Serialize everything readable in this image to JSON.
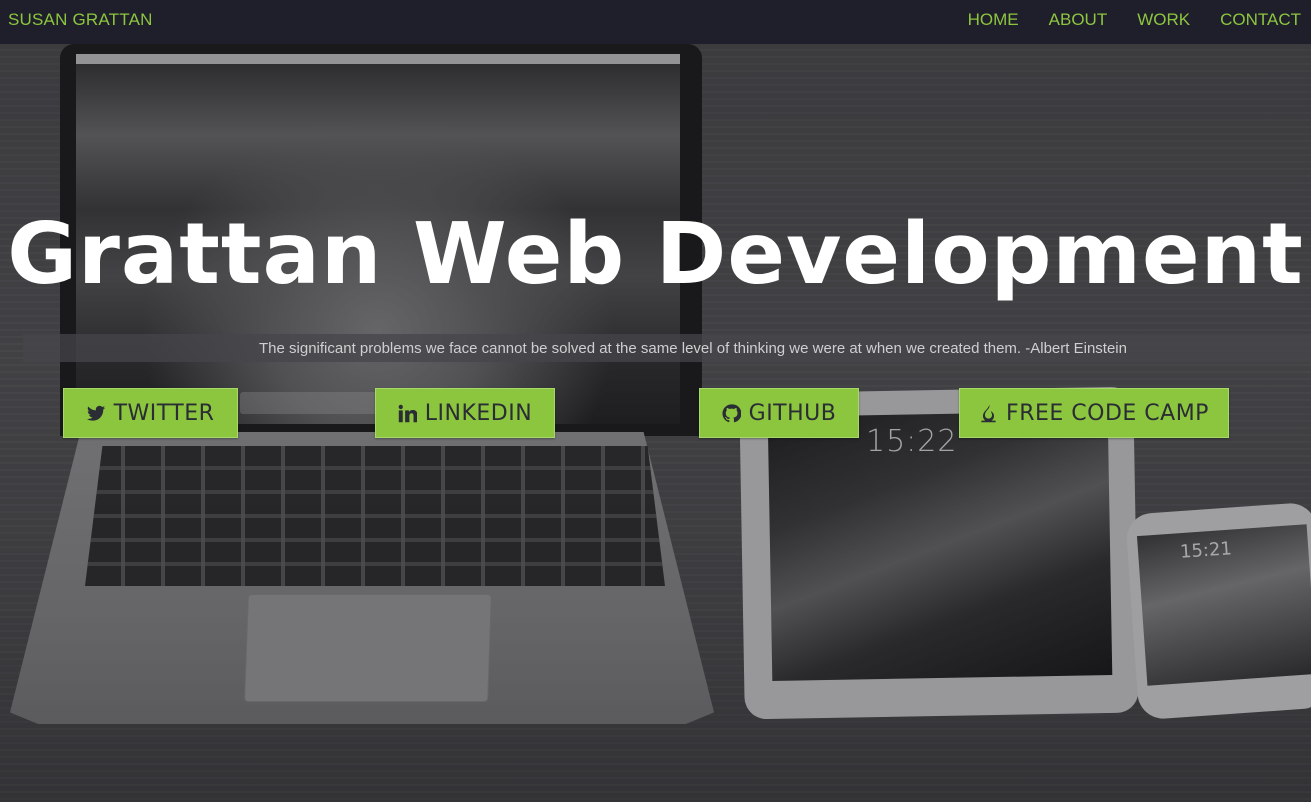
{
  "nav": {
    "brand": "SUSAN GRATTAN",
    "links": [
      "HOME",
      "ABOUT",
      "WORK",
      "CONTACT"
    ]
  },
  "hero": {
    "title": "Grattan Web Development",
    "quote": "The significant problems we face cannot be solved at the same level of thinking we were at when we created them. -Albert Einstein"
  },
  "social": [
    {
      "label": "TWITTER",
      "icon": "twitter-icon"
    },
    {
      "label": "LINKEDIN",
      "icon": "linkedin-icon"
    },
    {
      "label": "GITHUB",
      "icon": "github-icon"
    },
    {
      "label": "FREE CODE CAMP",
      "icon": "fire-icon"
    }
  ],
  "background": {
    "tablet_clock": "15:22",
    "phone_clock": "15:21"
  },
  "colors": {
    "accent": "#8cc63f",
    "navbar": "#1f1e2b",
    "title": "#ffffff"
  }
}
